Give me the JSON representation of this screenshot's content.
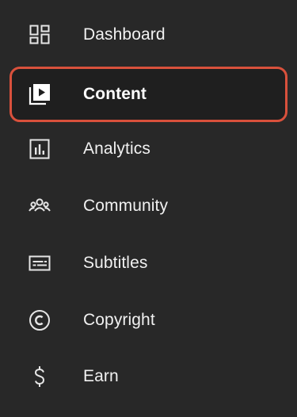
{
  "sidebar": {
    "accent_color": "#d9513c",
    "items": [
      {
        "label": "Dashboard",
        "icon": "dashboard-icon",
        "active": false
      },
      {
        "label": "Content",
        "icon": "content-play-icon",
        "active": true
      },
      {
        "label": "Analytics",
        "icon": "analytics-icon",
        "active": false
      },
      {
        "label": "Community",
        "icon": "community-icon",
        "active": false
      },
      {
        "label": "Subtitles",
        "icon": "subtitles-icon",
        "active": false
      },
      {
        "label": "Copyright",
        "icon": "copyright-icon",
        "active": false
      },
      {
        "label": "Earn",
        "icon": "dollar-icon",
        "active": false
      }
    ]
  }
}
